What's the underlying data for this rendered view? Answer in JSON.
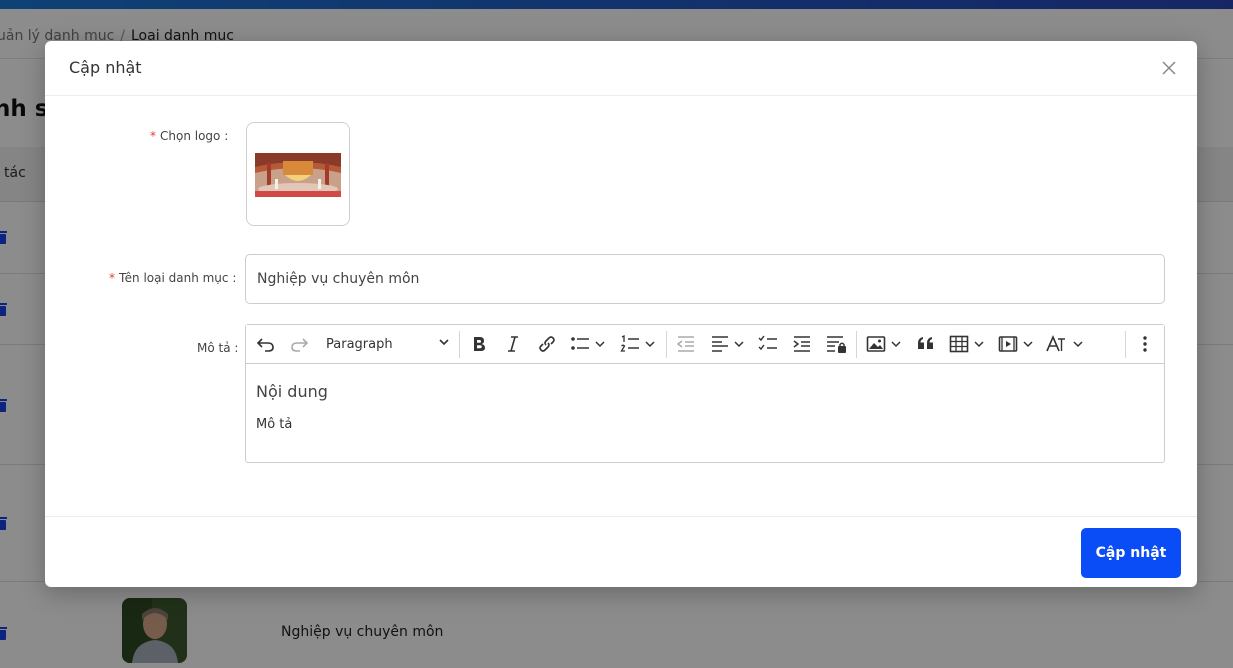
{
  "background": {
    "breadcrumb": {
      "parent": "uản lý danh mục",
      "separator": "/",
      "current": "Loại danh mục"
    },
    "page_title": "nh sá",
    "table": {
      "action_header": "tác",
      "rows": [
        {
          "name": ""
        },
        {
          "name": ""
        },
        {
          "name": ""
        },
        {
          "name": ""
        },
        {
          "name": "Nghiệp vụ chuyên môn"
        }
      ]
    }
  },
  "modal": {
    "title": "Cập nhật",
    "logo": {
      "label": "Chọn logo :",
      "required_mark": "*"
    },
    "name": {
      "label": "Tên loại danh mục :",
      "required_mark": "*",
      "value": "Nghiệp vụ chuyên môn"
    },
    "description": {
      "label": "Mô tả :",
      "toolbar": {
        "paragraph_select": "Paragraph",
        "icons": [
          "undo-icon",
          "redo-icon",
          "bold-icon",
          "italic-icon",
          "link-icon",
          "bulleted-list-icon",
          "numbered-list-icon",
          "outdent-icon",
          "align-icon",
          "todo-list-icon",
          "indent-icon",
          "restricted-editing-icon",
          "image-icon",
          "blockquote-icon",
          "table-icon",
          "media-icon",
          "text-style-icon",
          "more-icon"
        ]
      },
      "content": {
        "heading": "Nội dung",
        "paragraph": "Mô tả"
      }
    },
    "submit_label": "Cập nhật"
  },
  "colors": {
    "primary": "#0a4cf5",
    "required": "#e53935",
    "top_bar": "#2358c4"
  }
}
